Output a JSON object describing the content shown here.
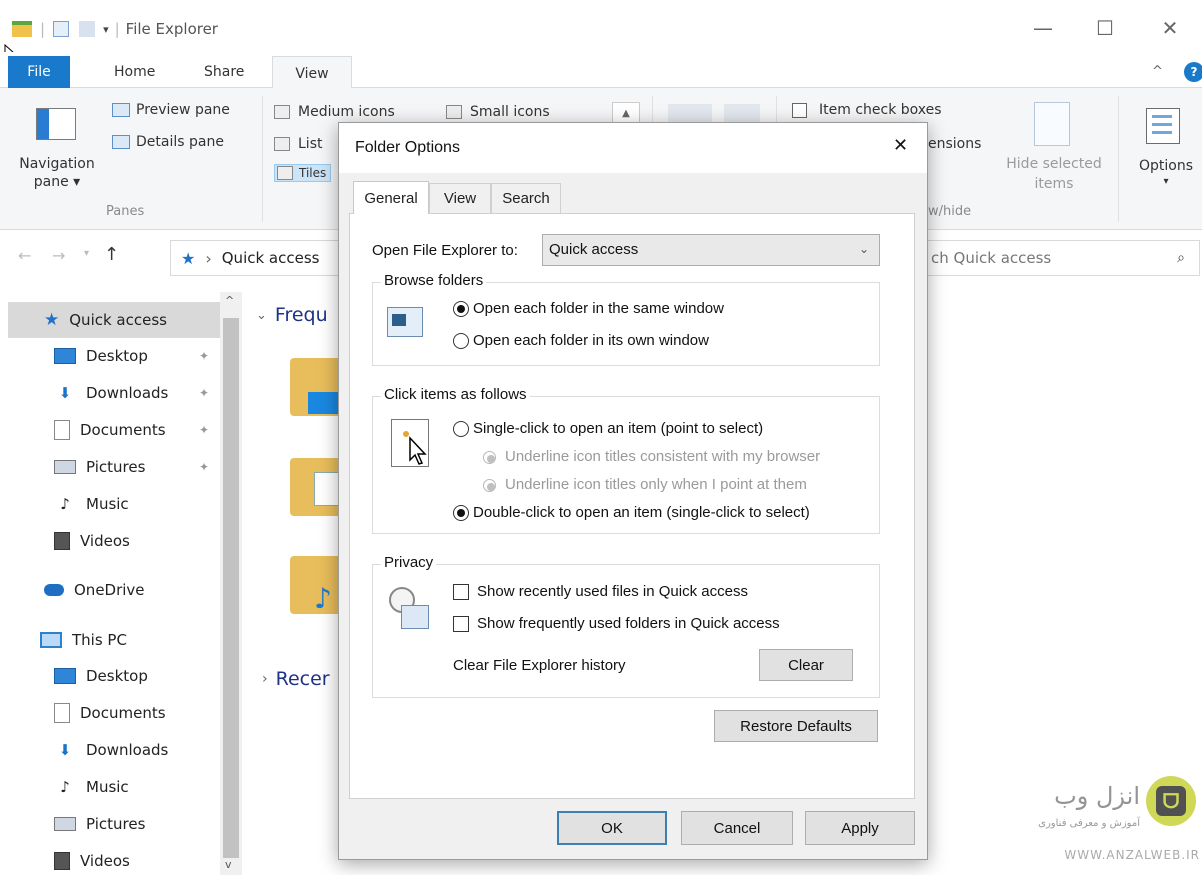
{
  "window": {
    "title": "File Explorer",
    "quick_access_sep": "|",
    "controls": {
      "minimize": "—",
      "maximize": "☐",
      "close": "✕"
    }
  },
  "ribbon": {
    "tabs": {
      "file": "File",
      "home": "Home",
      "share": "Share",
      "view": "View"
    },
    "panes_group": {
      "navigation_pane_line1": "Navigation",
      "navigation_pane_line2": "pane ▾",
      "preview_pane": "Preview pane",
      "details_pane": "Details pane",
      "label": "Panes"
    },
    "layout_group": {
      "medium_icons": "Medium icons",
      "small_icons": "Small icons",
      "list": "List",
      "tiles": "Tiles"
    },
    "show_hide_group": {
      "item_check_boxes": "Item check boxes",
      "extensions_partial": "ensions",
      "hide_selected_line1": "Hide selected",
      "hide_selected_line2": "items",
      "label_partial": "w/hide"
    },
    "options": {
      "label": "Options",
      "arrow": "▾"
    }
  },
  "address_bar": {
    "path_partial": "Quick access",
    "separator": "›",
    "search_placeholder_partial": "ch Quick access"
  },
  "nav_pane": {
    "quick_access": "Quick access",
    "quick_items": [
      {
        "label": "Desktop",
        "icon": "desktop-icon"
      },
      {
        "label": "Downloads",
        "icon": "downloads-icon"
      },
      {
        "label": "Documents",
        "icon": "documents-icon"
      },
      {
        "label": "Pictures",
        "icon": "pictures-icon"
      },
      {
        "label": "Music",
        "icon": "music-icon"
      },
      {
        "label": "Videos",
        "icon": "videos-icon"
      }
    ],
    "onedrive": "OneDrive",
    "this_pc": "This PC",
    "pc_items": [
      {
        "label": "Desktop",
        "icon": "desktop-icon"
      },
      {
        "label": "Documents",
        "icon": "documents-icon"
      },
      {
        "label": "Downloads",
        "icon": "downloads-icon"
      },
      {
        "label": "Music",
        "icon": "music-icon"
      },
      {
        "label": "Pictures",
        "icon": "pictures-icon"
      },
      {
        "label": "Videos",
        "icon": "videos-icon"
      }
    ]
  },
  "main": {
    "frequent_header_partial": "Frequ",
    "recent_header_partial": "Recer"
  },
  "dialog": {
    "title": "Folder Options",
    "close": "✕",
    "tabs": {
      "general": "General",
      "view": "View",
      "search": "Search"
    },
    "open_to_label": "Open File Explorer to:",
    "open_to_value": "Quick access",
    "browse_folders": {
      "legend": "Browse folders",
      "same_window": "Open each folder in the same window",
      "own_window": "Open each folder in its own window"
    },
    "click_items": {
      "legend": "Click items as follows",
      "single_click": "Single-click to open an item (point to select)",
      "underline_browser": "Underline icon titles consistent with my browser",
      "underline_point": "Underline icon titles only when I point at them",
      "double_click": "Double-click to open an item (single-click to select)"
    },
    "privacy": {
      "legend": "Privacy",
      "recent_files": "Show recently used files in Quick access",
      "frequent_folders": "Show frequently used folders in Quick access",
      "clear_history_label": "Clear File Explorer history",
      "clear_button": "Clear"
    },
    "restore_defaults": "Restore Defaults",
    "buttons": {
      "ok": "OK",
      "cancel": "Cancel",
      "apply": "Apply"
    }
  },
  "watermark": {
    "brand": "انزل وب",
    "tagline": "آموزش و معرفی فناوری",
    "url": "WWW.ANZALWEB.IR"
  },
  "colors": {
    "accent": "#1979ca",
    "ribbon_bg": "#f5f6f7",
    "dialog_bg": "#f0f0f0",
    "nav_selected": "#d9d9d9",
    "folder": "#e8bd5b"
  }
}
